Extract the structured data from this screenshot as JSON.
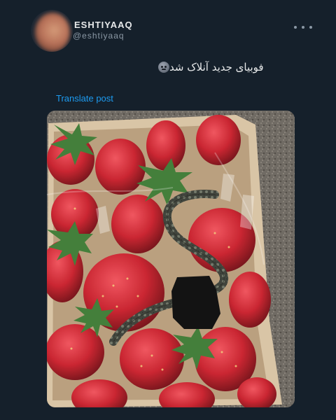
{
  "author": {
    "display_name": "ESHTIYAAQ",
    "handle": "@eshtiyaaq",
    "avatar_icon": "avatar-blurred"
  },
  "post": {
    "text": "فوبیای جدید آنلاک شد",
    "emoji": "gray-face-emoji",
    "translate_label": "Translate post",
    "more_icon": "more-options-icon"
  },
  "media": {
    "description_icon": "photo-strawberries-with-snake"
  },
  "colors": {
    "background": "#15202b",
    "link": "#1d9bf0",
    "secondary_text": "#8b98a5"
  }
}
